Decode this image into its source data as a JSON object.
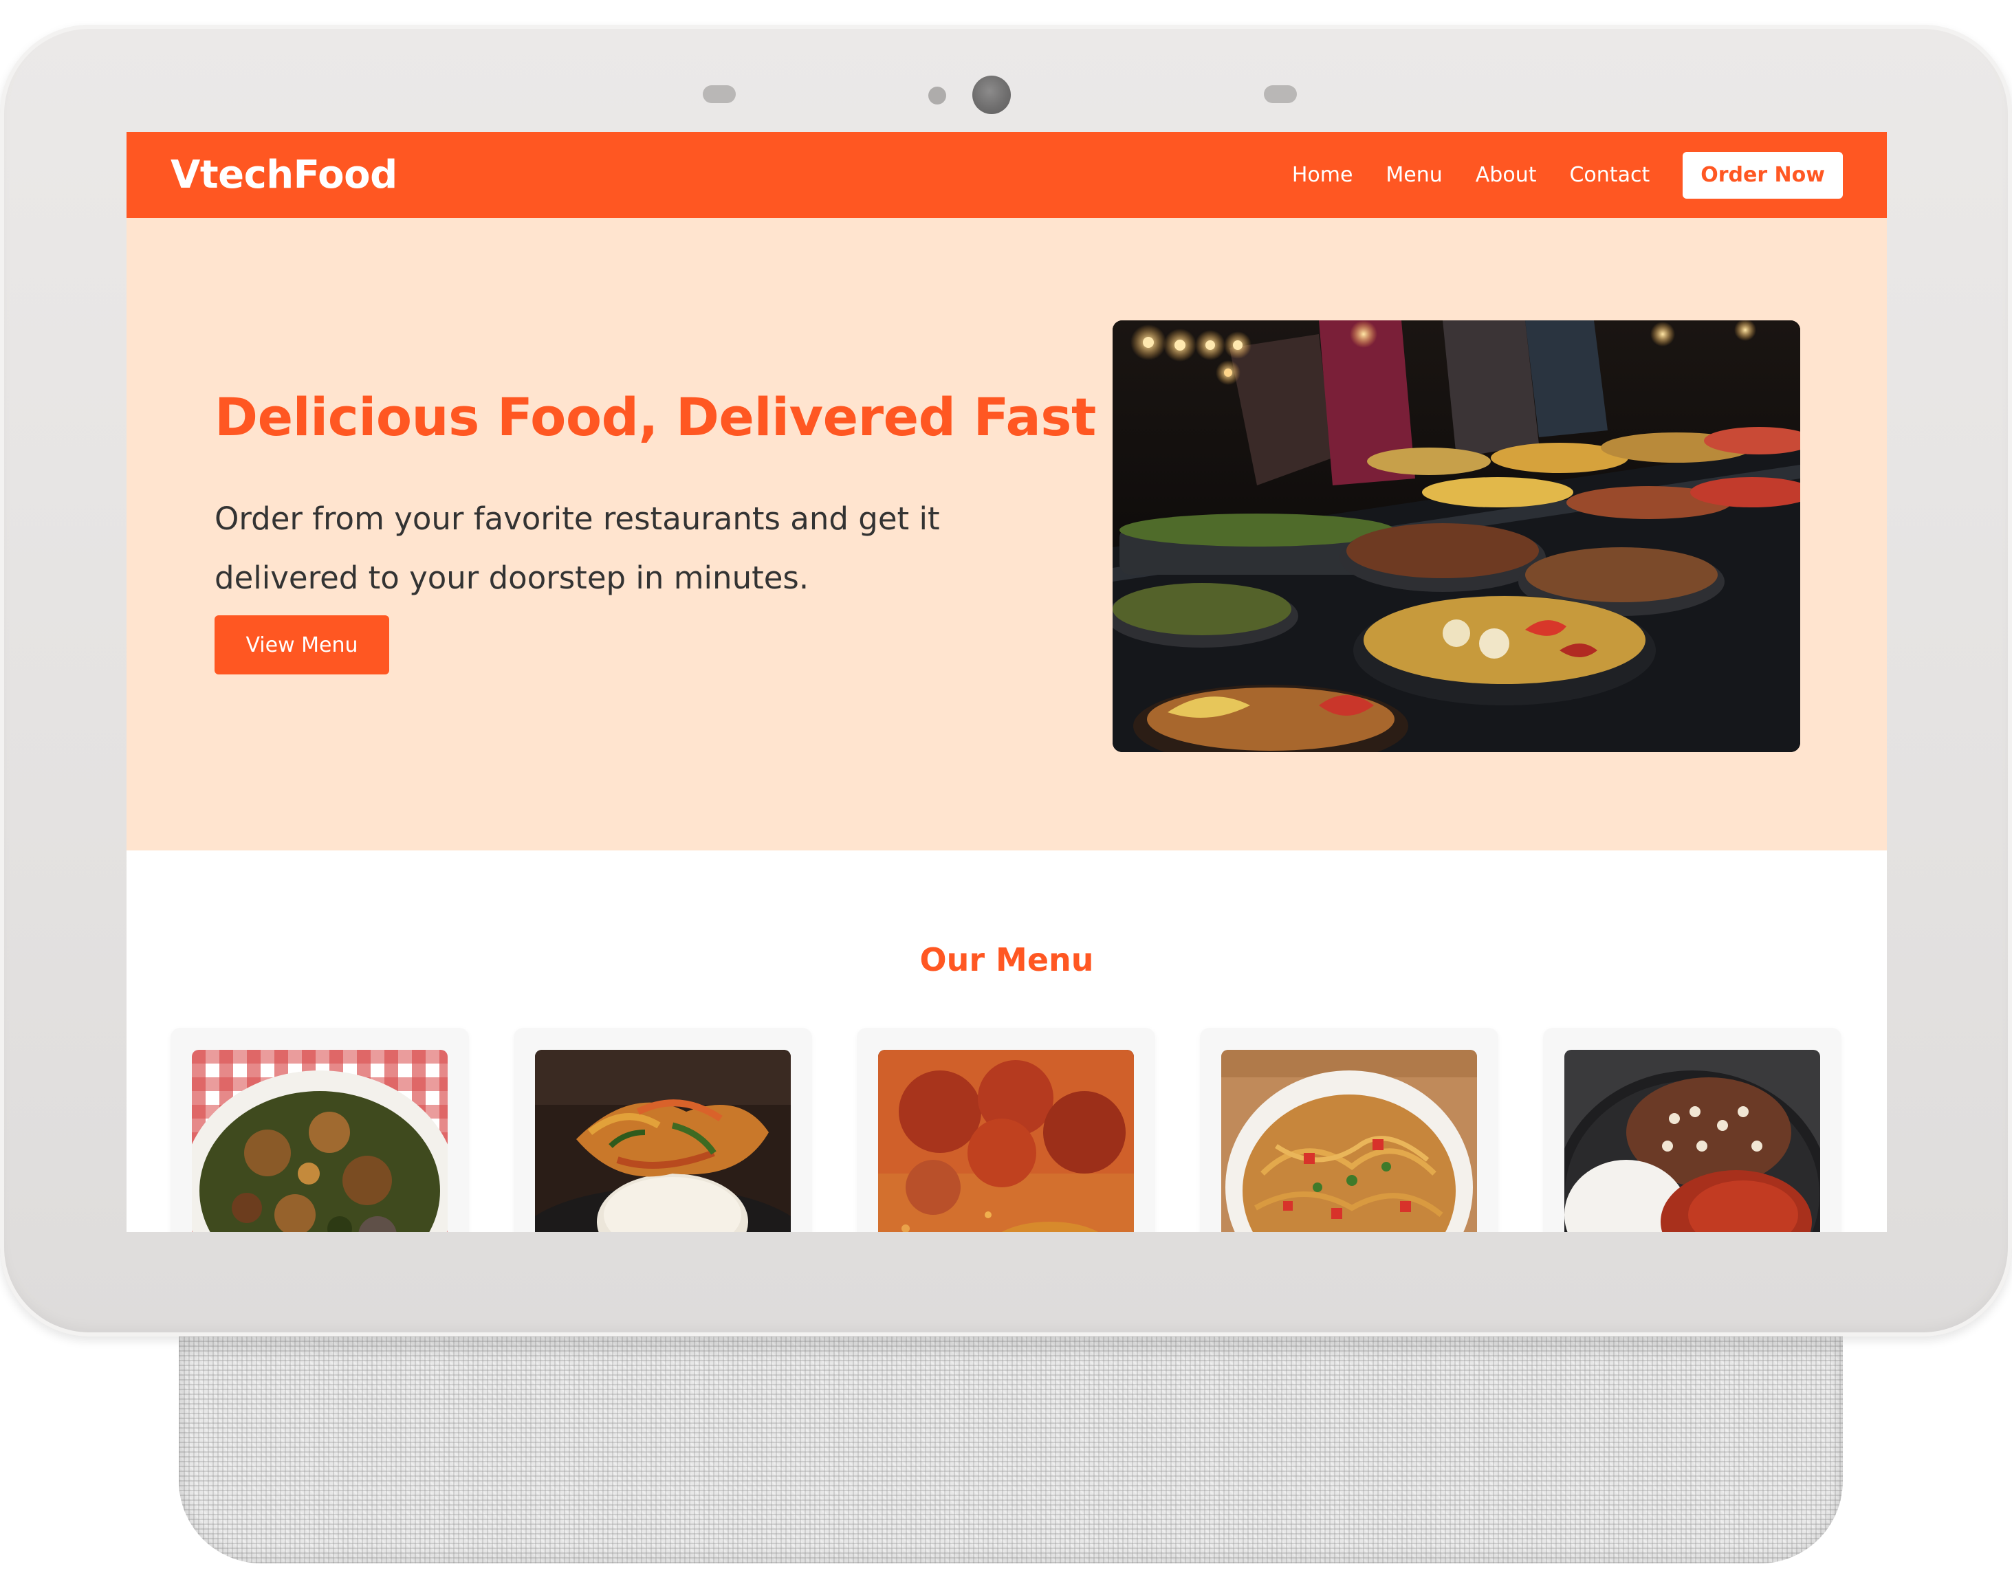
{
  "header": {
    "brand": "VtechFood",
    "nav": {
      "home": "Home",
      "menu": "Menu",
      "about": "About",
      "contact": "Contact"
    },
    "cta": "Order Now"
  },
  "hero": {
    "title": "Delicious Food, Delivered Fast",
    "text": "Order from your favorite restaurants and get it delivered to your doorstep in minutes.",
    "button": "View Menu",
    "image": "buffet-photo"
  },
  "menu_section": {
    "title": "Our Menu",
    "items": [
      {
        "image": "vegetable-soup-photo"
      },
      {
        "image": "pounded-yam-stew-photo"
      },
      {
        "image": "jollof-rice-chicken-photo"
      },
      {
        "image": "spaghetti-bowl-photo"
      },
      {
        "image": "rice-beans-stew-photo"
      }
    ]
  },
  "colors": {
    "accent": "#ff5722",
    "hero_bg": "#ffe4cf",
    "text": "#333333"
  }
}
